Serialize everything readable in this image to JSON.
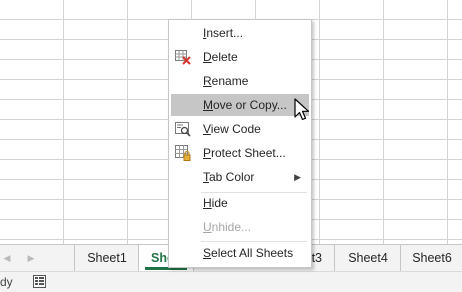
{
  "grid": {},
  "tabs": {
    "items": [
      {
        "label": "Sheet1"
      },
      {
        "label": "She"
      },
      {
        "label": "t3"
      },
      {
        "label": "Sheet4"
      },
      {
        "label": "Sheet6"
      }
    ],
    "active_color": "#217346"
  },
  "status": {
    "text": "dy",
    "macro_icon": "macro-record-icon"
  },
  "context_menu": {
    "items": [
      {
        "pre": "",
        "u": "I",
        "post": "nsert...",
        "icon": null,
        "enabled": true
      },
      {
        "pre": "",
        "u": "D",
        "post": "elete",
        "icon": "delete-sheet-icon",
        "enabled": true
      },
      {
        "pre": "",
        "u": "R",
        "post": "ename",
        "icon": null,
        "enabled": true
      },
      {
        "pre": "",
        "u": "M",
        "post": "ove or Copy...",
        "icon": null,
        "enabled": true,
        "highlighted": true
      },
      {
        "pre": "",
        "u": "V",
        "post": "iew Code",
        "icon": "view-code-icon",
        "enabled": true
      },
      {
        "pre": "",
        "u": "P",
        "post": "rotect Sheet...",
        "icon": "protect-sheet-icon",
        "enabled": true
      },
      {
        "pre": "",
        "u": "T",
        "post": "ab Color",
        "icon": null,
        "enabled": true,
        "submenu": true
      },
      {
        "pre": "",
        "u": "H",
        "post": "ide",
        "icon": null,
        "enabled": true
      },
      {
        "pre": "",
        "u": "U",
        "post": "nhide...",
        "icon": null,
        "enabled": false
      },
      {
        "pre": "",
        "u": "S",
        "post": "elect All Sheets",
        "icon": null,
        "enabled": true
      }
    ],
    "highlight_color": "#c6c6c6"
  }
}
